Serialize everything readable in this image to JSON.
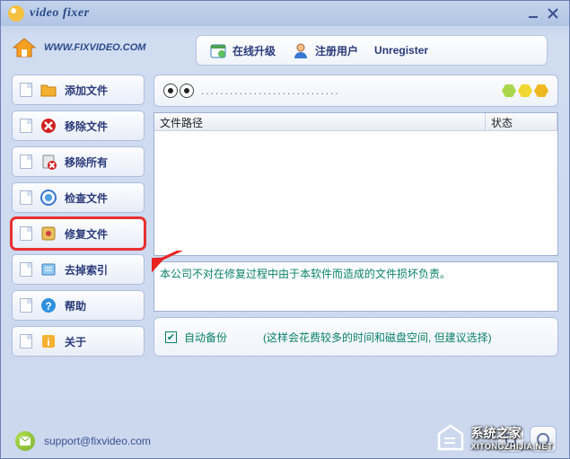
{
  "titlebar": {
    "app_name": "video fixer"
  },
  "url_text": "www.fixvideo.com",
  "toolbar": {
    "upgrade": "在线升级",
    "register": "注册用户",
    "unregister": "Unregister"
  },
  "sidebar": {
    "items": [
      {
        "label": "添加文件",
        "icon": "folder-add-icon"
      },
      {
        "label": "移除文件",
        "icon": "remove-icon"
      },
      {
        "label": "移除所有",
        "icon": "remove-all-icon"
      },
      {
        "label": "检查文件",
        "icon": "check-icon"
      },
      {
        "label": "修复文件",
        "icon": "repair-icon"
      },
      {
        "label": "去掉索引",
        "icon": "index-icon"
      },
      {
        "label": "帮助",
        "icon": "help-icon"
      },
      {
        "label": "关于",
        "icon": "about-icon"
      }
    ]
  },
  "list": {
    "col_path": "文件路径",
    "col_status": "状态"
  },
  "top_strip": {
    "dots": "............................."
  },
  "message": "本公司不对在修复过程中由于本软件而造成的文件损坏负责。",
  "bottom": {
    "auto_backup": "自动备份",
    "hint": "(这样会花费较多的时间和磁盘空间, 但建议选择)",
    "checked": true
  },
  "footer": {
    "email": "support@fixvideo.com"
  },
  "watermark": {
    "line1": "系统之家",
    "line2": "XITONGZHIJIA.NET"
  }
}
